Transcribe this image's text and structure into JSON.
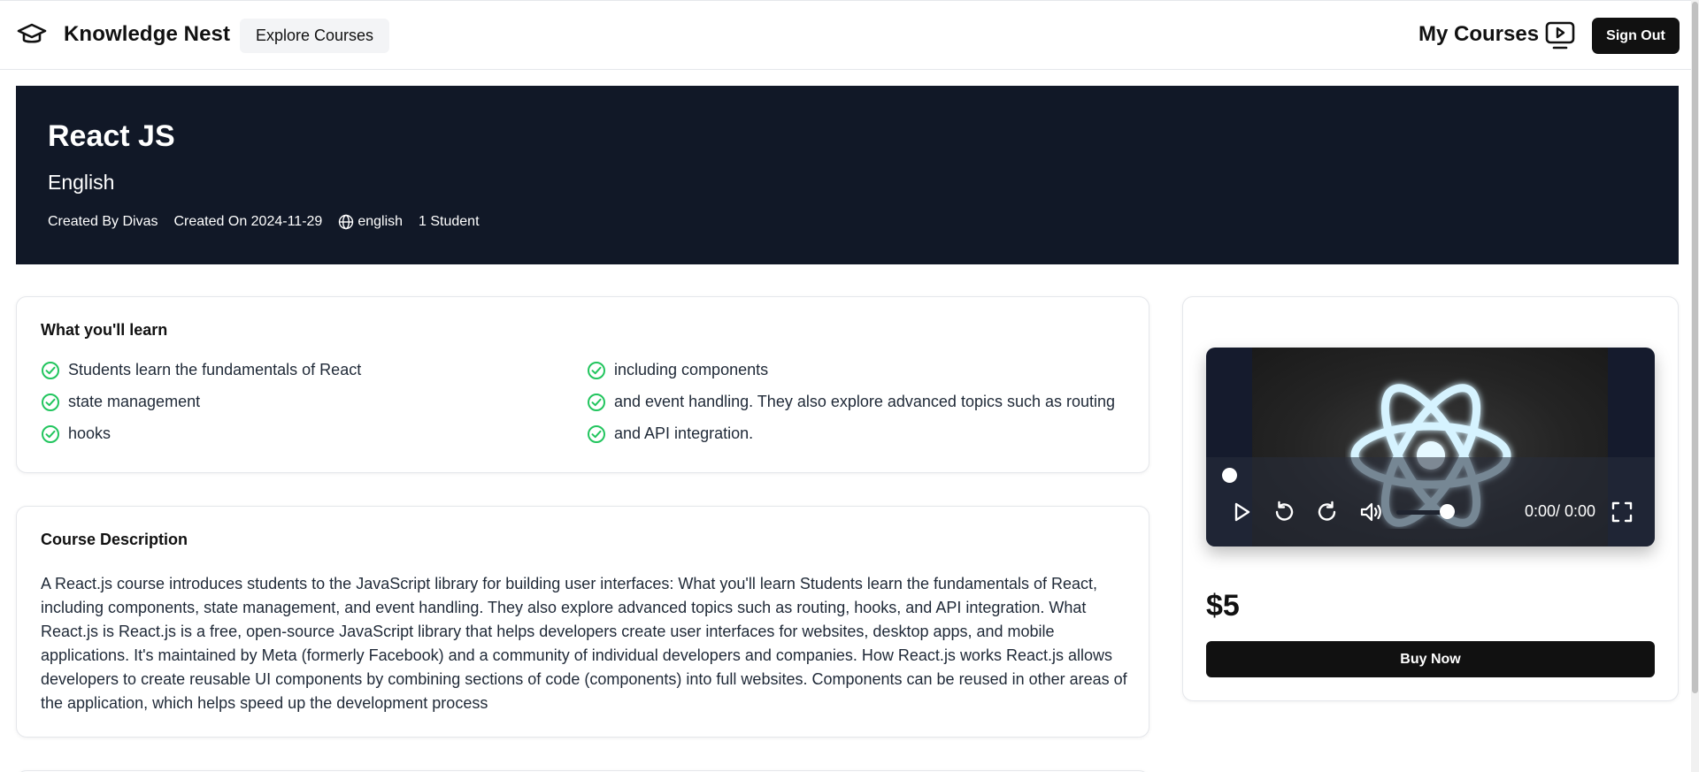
{
  "header": {
    "app_name": "Knowledge Nest",
    "explore_label": "Explore Courses",
    "my_courses_label": "My Courses",
    "sign_out_label": "Sign Out"
  },
  "course": {
    "title": "React JS",
    "subtitle": "English",
    "created_by": "Created By Divas",
    "created_on": "Created On 2024-11-29",
    "language": "english",
    "students": "1 Student"
  },
  "learn": {
    "heading": "What you'll learn",
    "items": [
      "Students learn the fundamentals of React",
      "including components",
      "state management",
      "and event handling. They also explore advanced topics such as routing",
      "hooks",
      "and API integration."
    ]
  },
  "description": {
    "heading": "Course Description",
    "text": "A React.js course introduces students to the JavaScript library for building user interfaces: What you'll learn Students learn the fundamentals of React, including components, state management, and event handling. They also explore advanced topics such as routing, hooks, and API integration. What React.js is React.js is a free, open-source JavaScript library that helps developers create user interfaces for websites, desktop apps, and mobile applications. It's maintained by Meta (formerly Facebook) and a community of individual developers and companies. How React.js works React.js allows developers to create reusable UI components by combining sections of code (components) into full websites. Components can be reused in other areas of the application, which helps speed up the development process"
  },
  "player": {
    "time": "0:00/ 0:00",
    "progress_fraction": 0,
    "volume_fraction": 0.75
  },
  "purchase": {
    "price": "$5",
    "buy_label": "Buy Now"
  },
  "colors": {
    "hero_bg": "#111827",
    "check_green": "#22c55e",
    "button_dark": "#111111"
  }
}
